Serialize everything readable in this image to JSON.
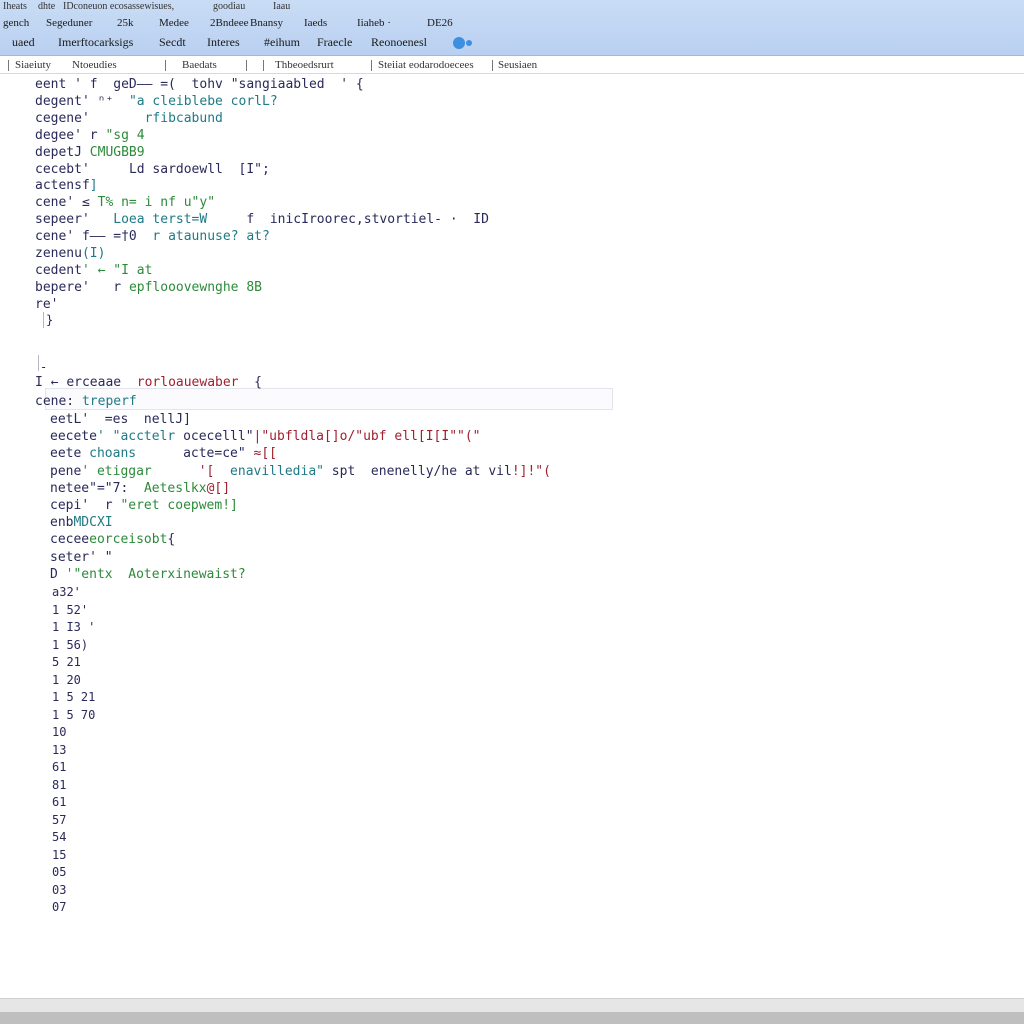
{
  "window": {
    "title_items": [
      "Iheats",
      "dhte",
      "IDconeuon ecosassewisues,",
      "goodiau",
      "Iaau"
    ]
  },
  "menu": {
    "items": [
      "gench",
      "Segeduner",
      "25k",
      "Medee",
      "2Bndeee",
      "Bnansy",
      "Iaeds",
      "Iiaheb ·",
      "DE26"
    ]
  },
  "toolbar": {
    "items": [
      "uaed",
      "Imerftocarksigs",
      "Secdt",
      "Interes",
      "#eihum",
      "Fraecle",
      "Reonoenesl"
    ],
    "info_icon": "info-icon"
  },
  "tabs": [
    "Siaeiuty",
    "Ntoeudies",
    "Baedats",
    "Thbeoedsrurt",
    "Steiiat eodarodoecees",
    "Seusiaen"
  ],
  "editor": {
    "lines": [
      [
        {
          "t": "eent",
          "c": "kw"
        },
        {
          "t": " ' f  geD—— =(  tohv ",
          "c": "kw"
        },
        {
          "t": "\"sangiaabled",
          "c": "kw"
        },
        {
          "t": "  ' {",
          "c": "kw"
        }
      ],
      [
        {
          "t": "degent",
          "c": "kw"
        },
        {
          "t": "' ⁿ⁺  ",
          "c": "kw"
        },
        {
          "t": "\"a cleiblebe corlL?",
          "c": "teal"
        }
      ],
      [
        {
          "t": "cegene",
          "c": "kw"
        },
        {
          "t": "'       ",
          "c": "kw"
        },
        {
          "t": "rfibcabund",
          "c": "teal"
        }
      ],
      [
        {
          "t": "degee",
          "c": "kw"
        },
        {
          "t": "' r ",
          "c": "kw"
        },
        {
          "t": "\"sg 4",
          "c": "gr"
        }
      ],
      [
        {
          "t": "depetJ ",
          "c": "kw"
        },
        {
          "t": "CMUGBB9",
          "c": "gr"
        }
      ],
      [
        {
          "t": "cecebt",
          "c": "kw"
        },
        {
          "t": "'     ",
          "c": "kw"
        },
        {
          "t": "Ld sardoewll",
          "c": "kw"
        },
        {
          "t": "  [I\";",
          "c": "kw"
        }
      ],
      [
        {
          "t": "actensf",
          "c": "kw"
        },
        {
          "t": "]",
          "c": "teal"
        }
      ],
      [
        {
          "t": "cene",
          "c": "kw"
        },
        {
          "t": "' ≤ ",
          "c": "kw"
        },
        {
          "t": "T% n= i nf ",
          "c": "gr"
        },
        {
          "t": "u\"y\"",
          "c": "gr"
        }
      ],
      [
        {
          "t": "sepeer",
          "c": "kw"
        },
        {
          "t": "'   ",
          "c": "kw"
        },
        {
          "t": "Loea terst=W",
          "c": "teal"
        },
        {
          "t": "     f  inicIroorec,stvortiel- ·  ID",
          "c": "kw"
        }
      ],
      [
        {
          "t": "cene",
          "c": "kw"
        },
        {
          "t": "' f—— ",
          "c": "kw"
        },
        {
          "t": "=†0  ",
          "c": "kw"
        },
        {
          "t": "r ataunuse? at?",
          "c": "teal"
        }
      ],
      [
        {
          "t": "zenenu",
          "c": "kw"
        },
        {
          "t": "(I)",
          "c": "teal"
        }
      ],
      [
        {
          "t": "cedent",
          "c": "kw"
        },
        {
          "t": "' ← \"I at",
          "c": "gr"
        }
      ],
      [
        {
          "t": "bepere",
          "c": "kw"
        },
        {
          "t": "'   r ",
          "c": "kw"
        },
        {
          "t": "epflooovewnghe 8B",
          "c": "gr"
        }
      ],
      [
        {
          "t": "re",
          "c": "kw"
        },
        {
          "t": "'",
          "c": "kw"
        }
      ]
    ],
    "close_brace": "}",
    "lower_open": [
      {
        "t": "I ← ",
        "c": "kw"
      },
      {
        "t": "erceaae",
        "c": "kw"
      },
      {
        "t": "  ",
        "c": "kw"
      },
      {
        "t": "rorloauewaber",
        "c": "red"
      },
      {
        "t": "  {",
        "c": "kw"
      }
    ],
    "lower_head": [
      {
        "t": "cene:",
        "c": "kw"
      },
      {
        "t": " treperf",
        "c": "teal"
      }
    ],
    "lower_lines": [
      [
        {
          "t": "eetL",
          "c": "kw"
        },
        {
          "t": "'  ",
          "c": "kw"
        },
        {
          "t": "=es  nellJ]",
          "c": "kw"
        }
      ],
      [
        {
          "t": "eecete",
          "c": "kw"
        },
        {
          "t": "' \"acctelr",
          "c": "teal"
        },
        {
          "t": " ocecelll\"",
          "c": "kw"
        },
        {
          "t": "|\"ubfldla[]o/\"ub",
          "c": "red"
        },
        {
          "t": "f ell[I[I\"\"(\"",
          "c": "red"
        }
      ],
      [
        {
          "t": "eete",
          "c": "kw"
        },
        {
          "t": " choans",
          "c": "teal"
        },
        {
          "t": "      acte=ce\" ",
          "c": "kw"
        },
        {
          "t": "≈[[",
          "c": "red"
        }
      ],
      [
        {
          "t": "pene",
          "c": "kw"
        },
        {
          "t": "' etiggar",
          "c": "gr"
        },
        {
          "t": "      ",
          "c": "kw"
        },
        {
          "t": "'[  ",
          "c": "red"
        },
        {
          "t": "enavilledia\"",
          "c": "teal"
        },
        {
          "t": " spt  enenelly/he at vil",
          "c": "kw"
        },
        {
          "t": "!]!\"(",
          "c": "red"
        }
      ],
      [
        {
          "t": "netee",
          "c": "kw"
        },
        {
          "t": "\"=\"7:  ",
          "c": "kw"
        },
        {
          "t": "Aeteslkx",
          "c": "gr"
        },
        {
          "t": "@[]",
          "c": "red"
        }
      ],
      [
        {
          "t": "cepi",
          "c": "kw"
        },
        {
          "t": "'  r ",
          "c": "kw"
        },
        {
          "t": "\"eret coepwem!]",
          "c": "gr"
        }
      ],
      [
        {
          "t": "enb",
          "c": "kw"
        },
        {
          "t": "MDCXI",
          "c": "teal"
        }
      ],
      [
        {
          "t": "cecee",
          "c": "kw"
        },
        {
          "t": "eorceisobt",
          "c": "gr"
        },
        {
          "t": "{",
          "c": "kw"
        }
      ],
      [
        {
          "t": "seter",
          "c": "kw"
        },
        {
          "t": "' \"",
          "c": "kw"
        }
      ],
      [
        {
          "t": "D ",
          "c": "kw"
        },
        {
          "t": "'\"entx  ",
          "c": "gr"
        },
        {
          "t": "Aoterxinewaist?",
          "c": "gr"
        }
      ]
    ],
    "line_numbers": [
      "a32'",
      "1 52'",
      "1 I3 '",
      "1 56)",
      "5 21",
      "1 20",
      "1 5 21",
      "1 5 70",
      "10",
      "13",
      "61",
      "81",
      "61",
      "57",
      "54",
      "15",
      "05",
      "03",
      "07"
    ]
  }
}
